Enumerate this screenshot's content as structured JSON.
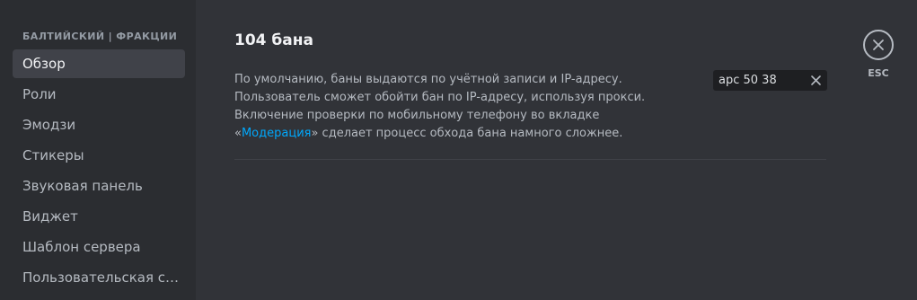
{
  "sidebar": {
    "header": "БАЛТИЙСКИЙ | ФРАКЦИИ",
    "items": [
      {
        "label": "Обзор"
      },
      {
        "label": "Роли"
      },
      {
        "label": "Эмодзи"
      },
      {
        "label": "Стикеры"
      },
      {
        "label": "Звуковая панель"
      },
      {
        "label": "Виджет"
      },
      {
        "label": "Шаблон сервера"
      },
      {
        "label": "Пользовательская сс..."
      }
    ],
    "selected_index": 0
  },
  "main": {
    "title": "104 бана",
    "description_before": "По умолчанию, баны выдаются по учётной записи и IP-адресу. Пользователь сможет обойти бан по IP-адресу, используя прокси. Включение проверки по мобильному телефону во вкладке «",
    "description_link": "Модерация",
    "description_after": "» сделает процесс обхода бана намного сложнее."
  },
  "search": {
    "value": "apc 50 38",
    "clear_icon": "close-icon"
  },
  "close": {
    "icon": "close-icon",
    "label": "ESC"
  },
  "colors": {
    "sidebar_bg": "#2b2d31",
    "content_bg": "#313338",
    "selected_bg": "#404249",
    "link": "#00a8fc"
  }
}
